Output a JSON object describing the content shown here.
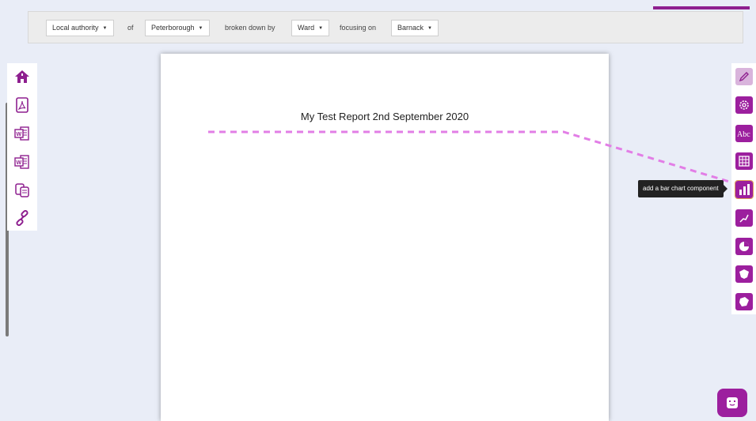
{
  "filters": {
    "level_select": "Local authority",
    "of_label": "of",
    "area_select": "Peterborough",
    "breakdown_label": "broken down by",
    "breakdown_select": "Ward",
    "focus_label": "focusing on",
    "focus_select": "Barnack",
    "caret": "▼"
  },
  "report": {
    "title": "My Test Report 2nd September 2020"
  },
  "right_toolbar": {
    "tooltip": "add a bar chart component"
  },
  "colors": {
    "accent": "#9c1f9e",
    "guide_line": "#e27ee6"
  },
  "icons": {
    "left": [
      "home-icon",
      "pdf-icon",
      "word-icon",
      "word-icon",
      "copy-icon",
      "link-icon"
    ],
    "right": [
      "pencil-icon",
      "gear-icon",
      "text-icon",
      "table-icon",
      "bar-chart-icon",
      "line-chart-icon",
      "pie-chart-icon",
      "map-icon",
      "map-icon",
      "chat-icon"
    ]
  }
}
